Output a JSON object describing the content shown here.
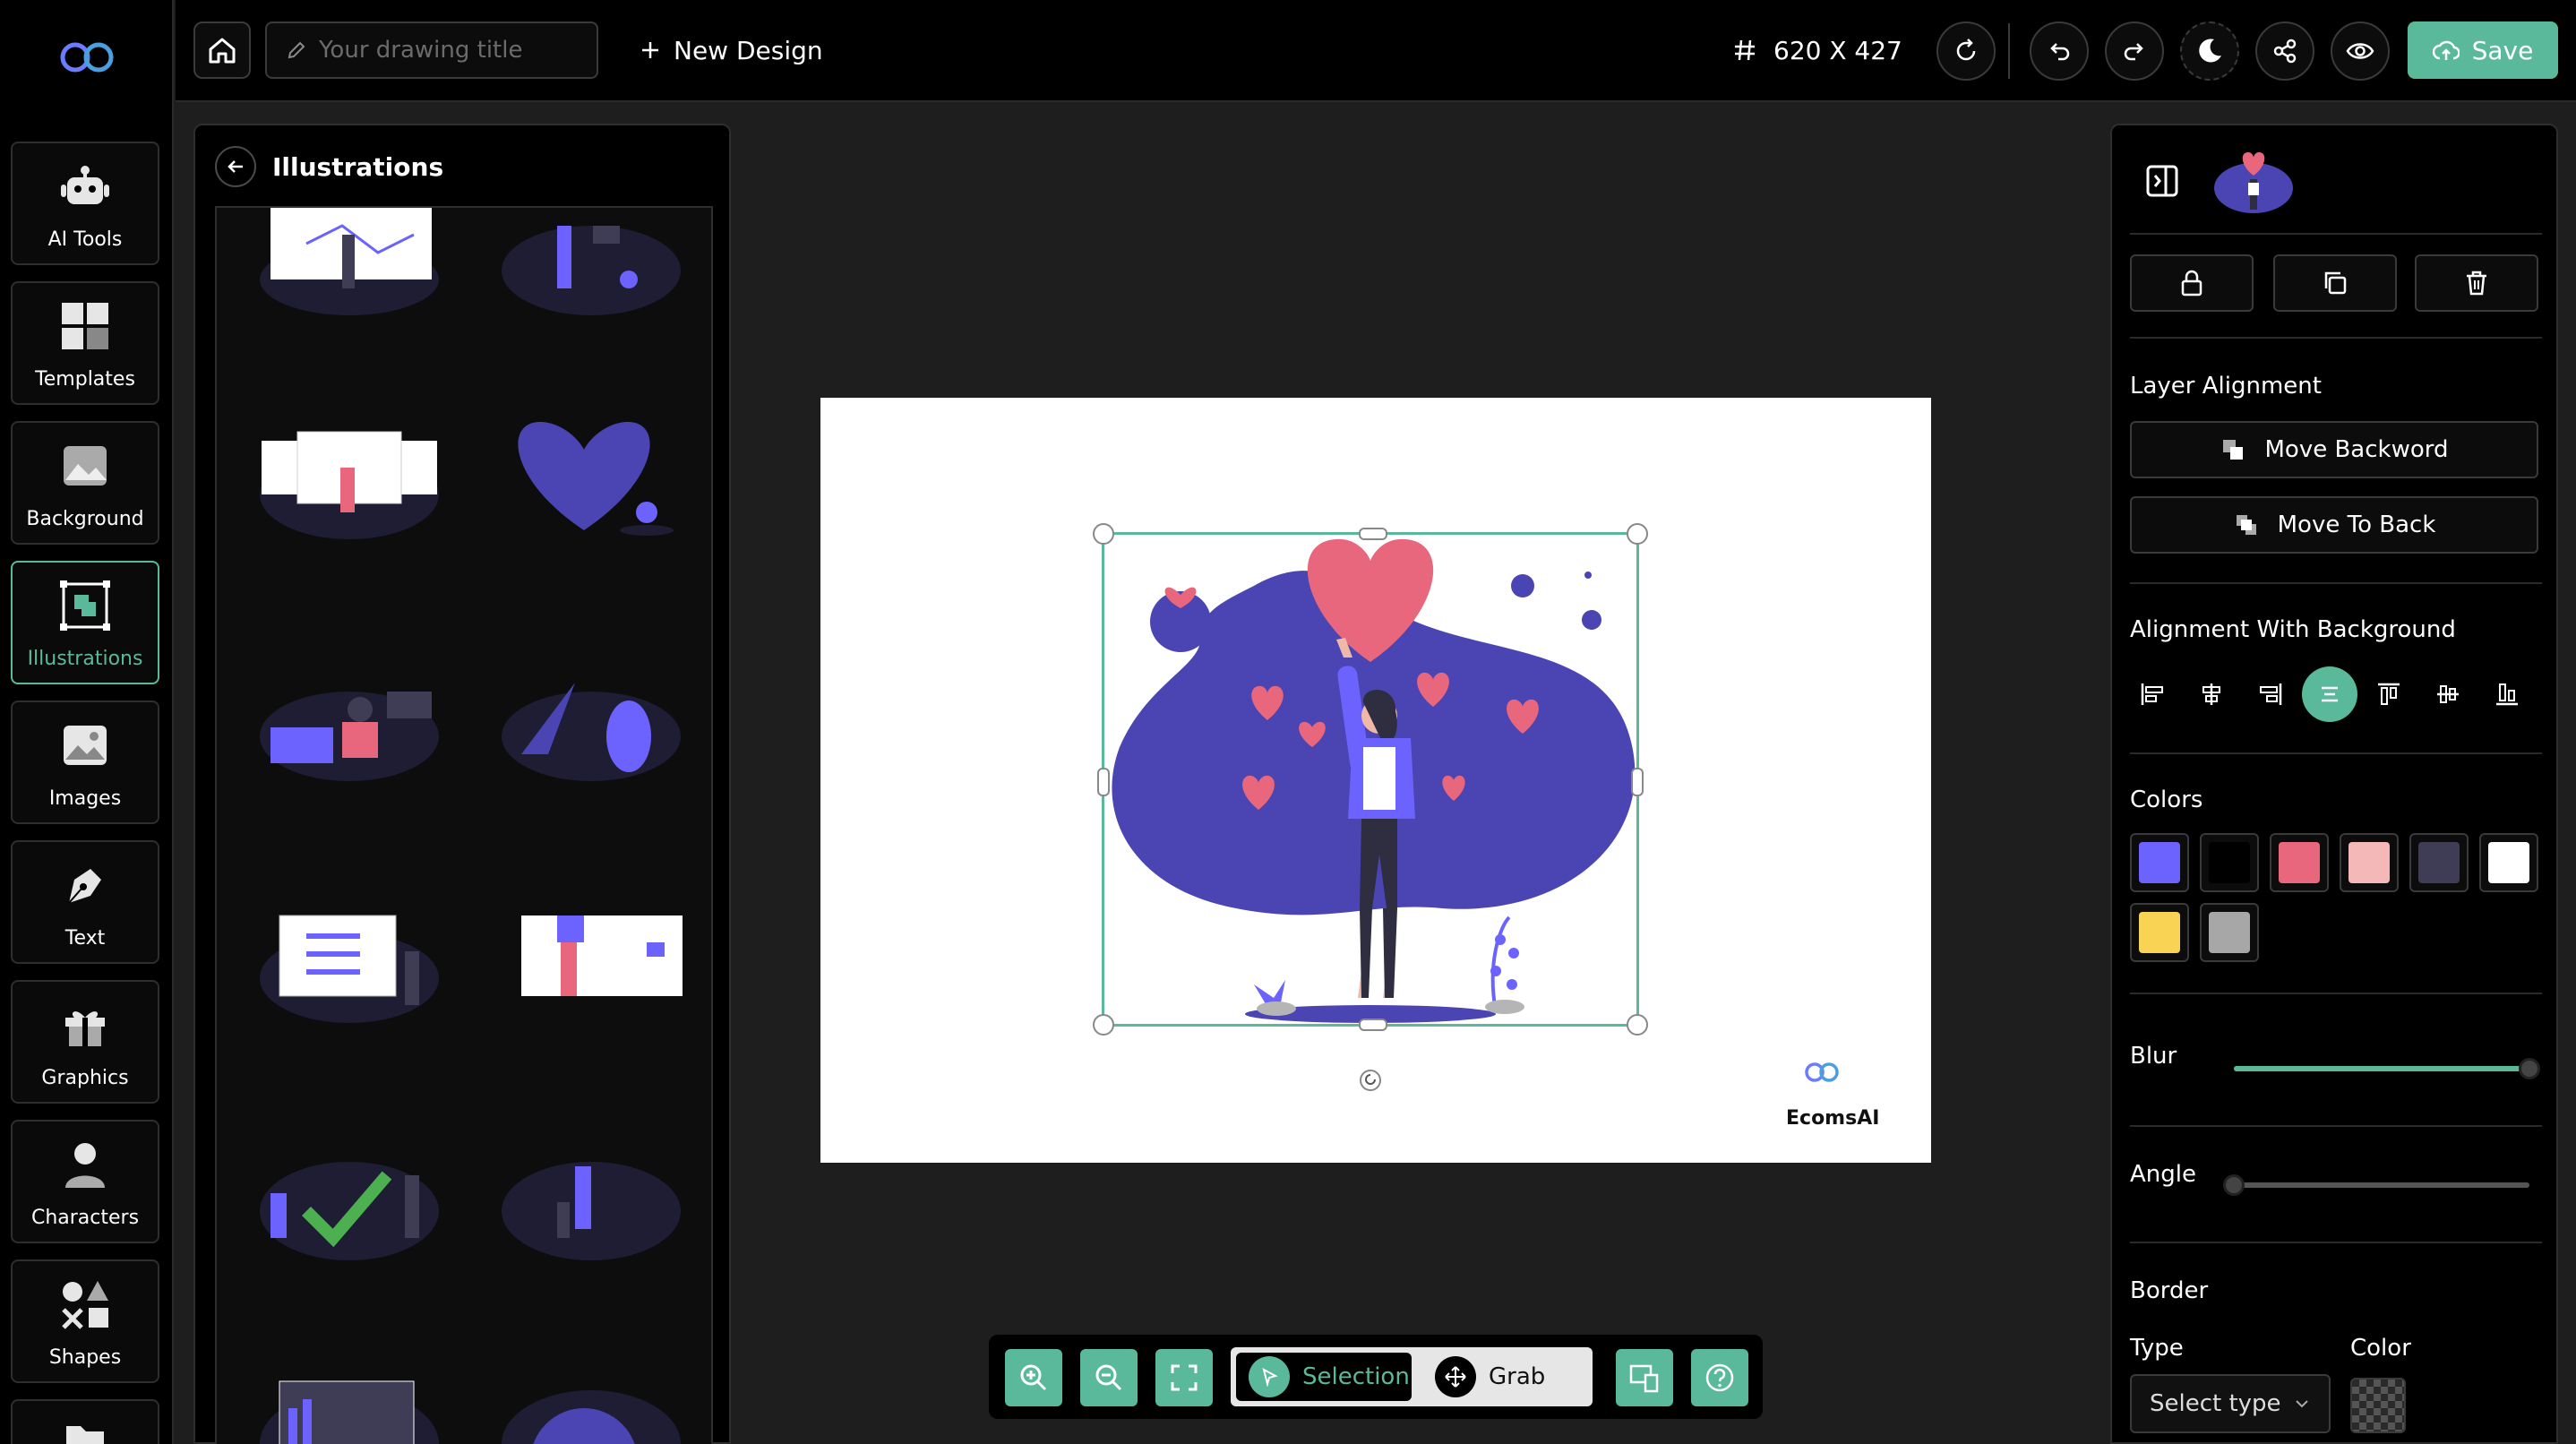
{
  "topbar": {
    "title_placeholder": "Your drawing title",
    "new_design_label": "New Design",
    "canvas_size": "620 X 427",
    "save_label": "Save"
  },
  "sidebar": {
    "items": [
      {
        "label": "AI Tools",
        "icon": "robot-icon"
      },
      {
        "label": "Templates",
        "icon": "templates-grid-icon"
      },
      {
        "label": "Background",
        "icon": "background-image-icon"
      },
      {
        "label": "Illustrations",
        "icon": "illustrations-icon",
        "active": true
      },
      {
        "label": "Images",
        "icon": "image-icon"
      },
      {
        "label": "Text",
        "icon": "pen-nib-icon"
      },
      {
        "label": "Graphics",
        "icon": "gift-icon"
      },
      {
        "label": "Characters",
        "icon": "person-icon"
      },
      {
        "label": "Shapes",
        "icon": "shapes-icon"
      }
    ]
  },
  "illustrations_panel": {
    "title": "Illustrations"
  },
  "canvas": {
    "brand_name": "EcomsAI"
  },
  "bottom_toolbar": {
    "selection_label": "Selection",
    "grab_label": "Grab",
    "active_mode": "Selection"
  },
  "right_panel": {
    "layer_alignment_heading": "Layer Alignment",
    "move_backward_label": "Move Backword",
    "move_to_back_label": "Move To Back",
    "bg_alignment_heading": "Alignment With Background",
    "colors_heading": "Colors",
    "colors": [
      "#6c63ff",
      "#000000",
      "#e8677c",
      "#f4b8b8",
      "#3f3d56",
      "#ffffff",
      "#f9d354",
      "#a7a7a7"
    ],
    "blur_label": "Blur",
    "blur_value": 1.0,
    "angle_label": "Angle",
    "angle_value": 0,
    "border_heading": "Border",
    "type_label": "Type",
    "color_label": "Color",
    "type_select_value": "Select type"
  },
  "accent_color": "#5ab99a"
}
